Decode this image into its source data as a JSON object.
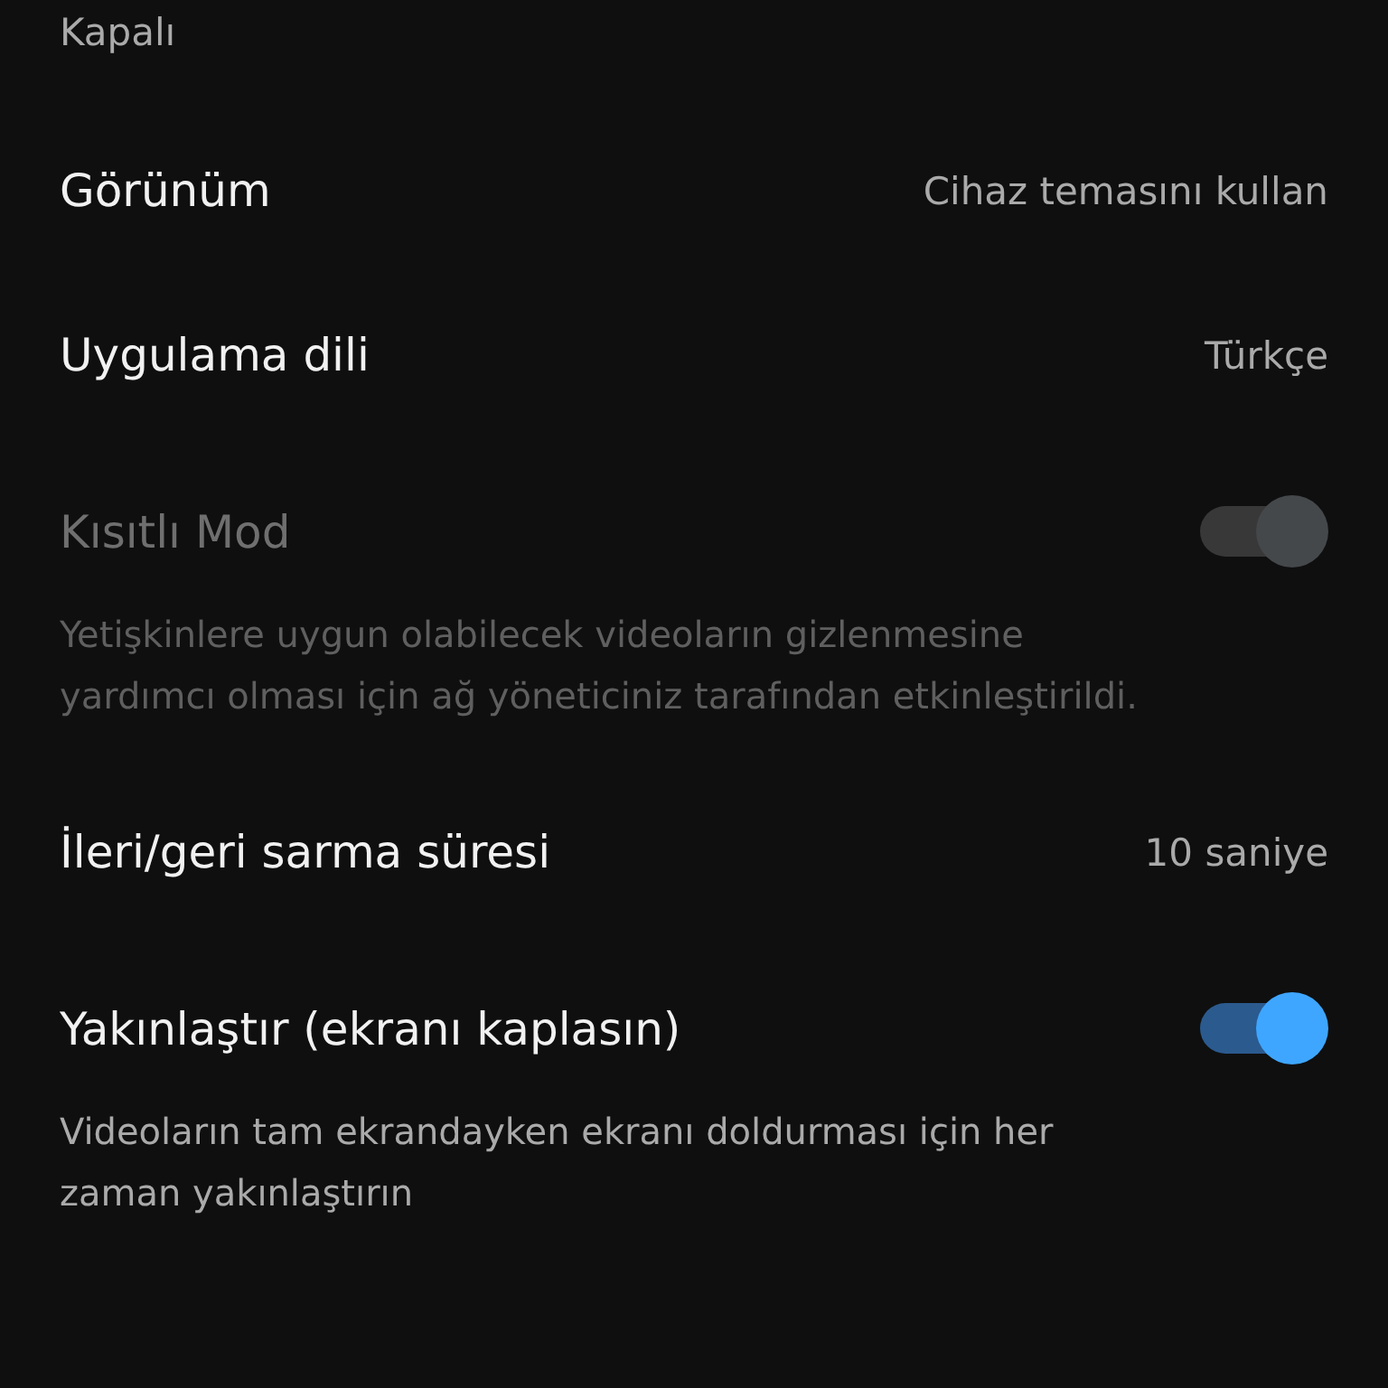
{
  "top_text": "Kapalı",
  "settings": [
    {
      "kind": "value",
      "title": "Görünüm",
      "value": "Cihaz temasını kullan"
    },
    {
      "kind": "value",
      "title": "Uygulama dili",
      "value": "Türkçe"
    },
    {
      "kind": "toggle",
      "title": "Kısıtlı Mod",
      "on": true,
      "disabled": true,
      "description": "Yetişkinlere uygun olabilecek videoların gizlenmesine yardımcı olması için ağ yöneticiniz tarafından etkinleştirildi."
    },
    {
      "kind": "value",
      "title": "İleri/geri sarma süresi",
      "value": "10 saniye"
    },
    {
      "kind": "toggle",
      "title": "Yakınlaştır (ekranı kaplasın)",
      "on": true,
      "disabled": false,
      "description": "Videoların tam ekrandayken ekranı doldurması için her zaman yakınlaştırın"
    }
  ]
}
